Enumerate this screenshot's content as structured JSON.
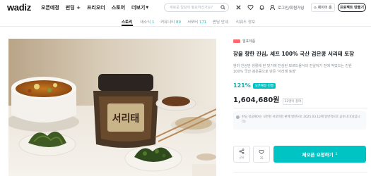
{
  "header": {
    "logo": "wadiz",
    "nav": [
      "오픈예정",
      "펀딩 +",
      "프리오더",
      "스토어",
      "더보기"
    ],
    "search_placeholder": "새로운 일상이 필요하신가요?",
    "login": "로그인/회원가입",
    "wish_label": "제이어 홈",
    "maker_label": "프로젝트 만들기"
  },
  "tabs": {
    "items": [
      "스토리",
      "새소식",
      "커뮤니티",
      "서포터",
      "펀딩 안내",
      "리워드 정보"
    ],
    "counts": [
      "",
      "1",
      "89",
      "171",
      "",
      ""
    ]
  },
  "product": {
    "maker": "웹표제품",
    "title": "장을 향한 진심, 셰프 100% 국산 검은콩 서리태 토장",
    "description": "현미 진심만 생활에 된 맛기에 진심된 보르드음식의 진날이기 전에 적었드는 진원 100% 국산 검은콩으로 만든 '서리태 토장'",
    "rate": "121%",
    "rate_tag": "오픈예정 진행",
    "amount": "1,604,680원",
    "amount_tag": "32명이 참여",
    "notice": "펀딩 성공해야는 오픈된 서로이런 판매 발현으로 2025.03.12에 일반적으로 공유니다(성공니다)"
  },
  "actions": {
    "share_label": "공유",
    "like_count": "35",
    "cta_label": "제오픈 요청하기",
    "cta_count": "5"
  },
  "colors": {
    "accent": "#00c4c4",
    "text": "#212529"
  }
}
